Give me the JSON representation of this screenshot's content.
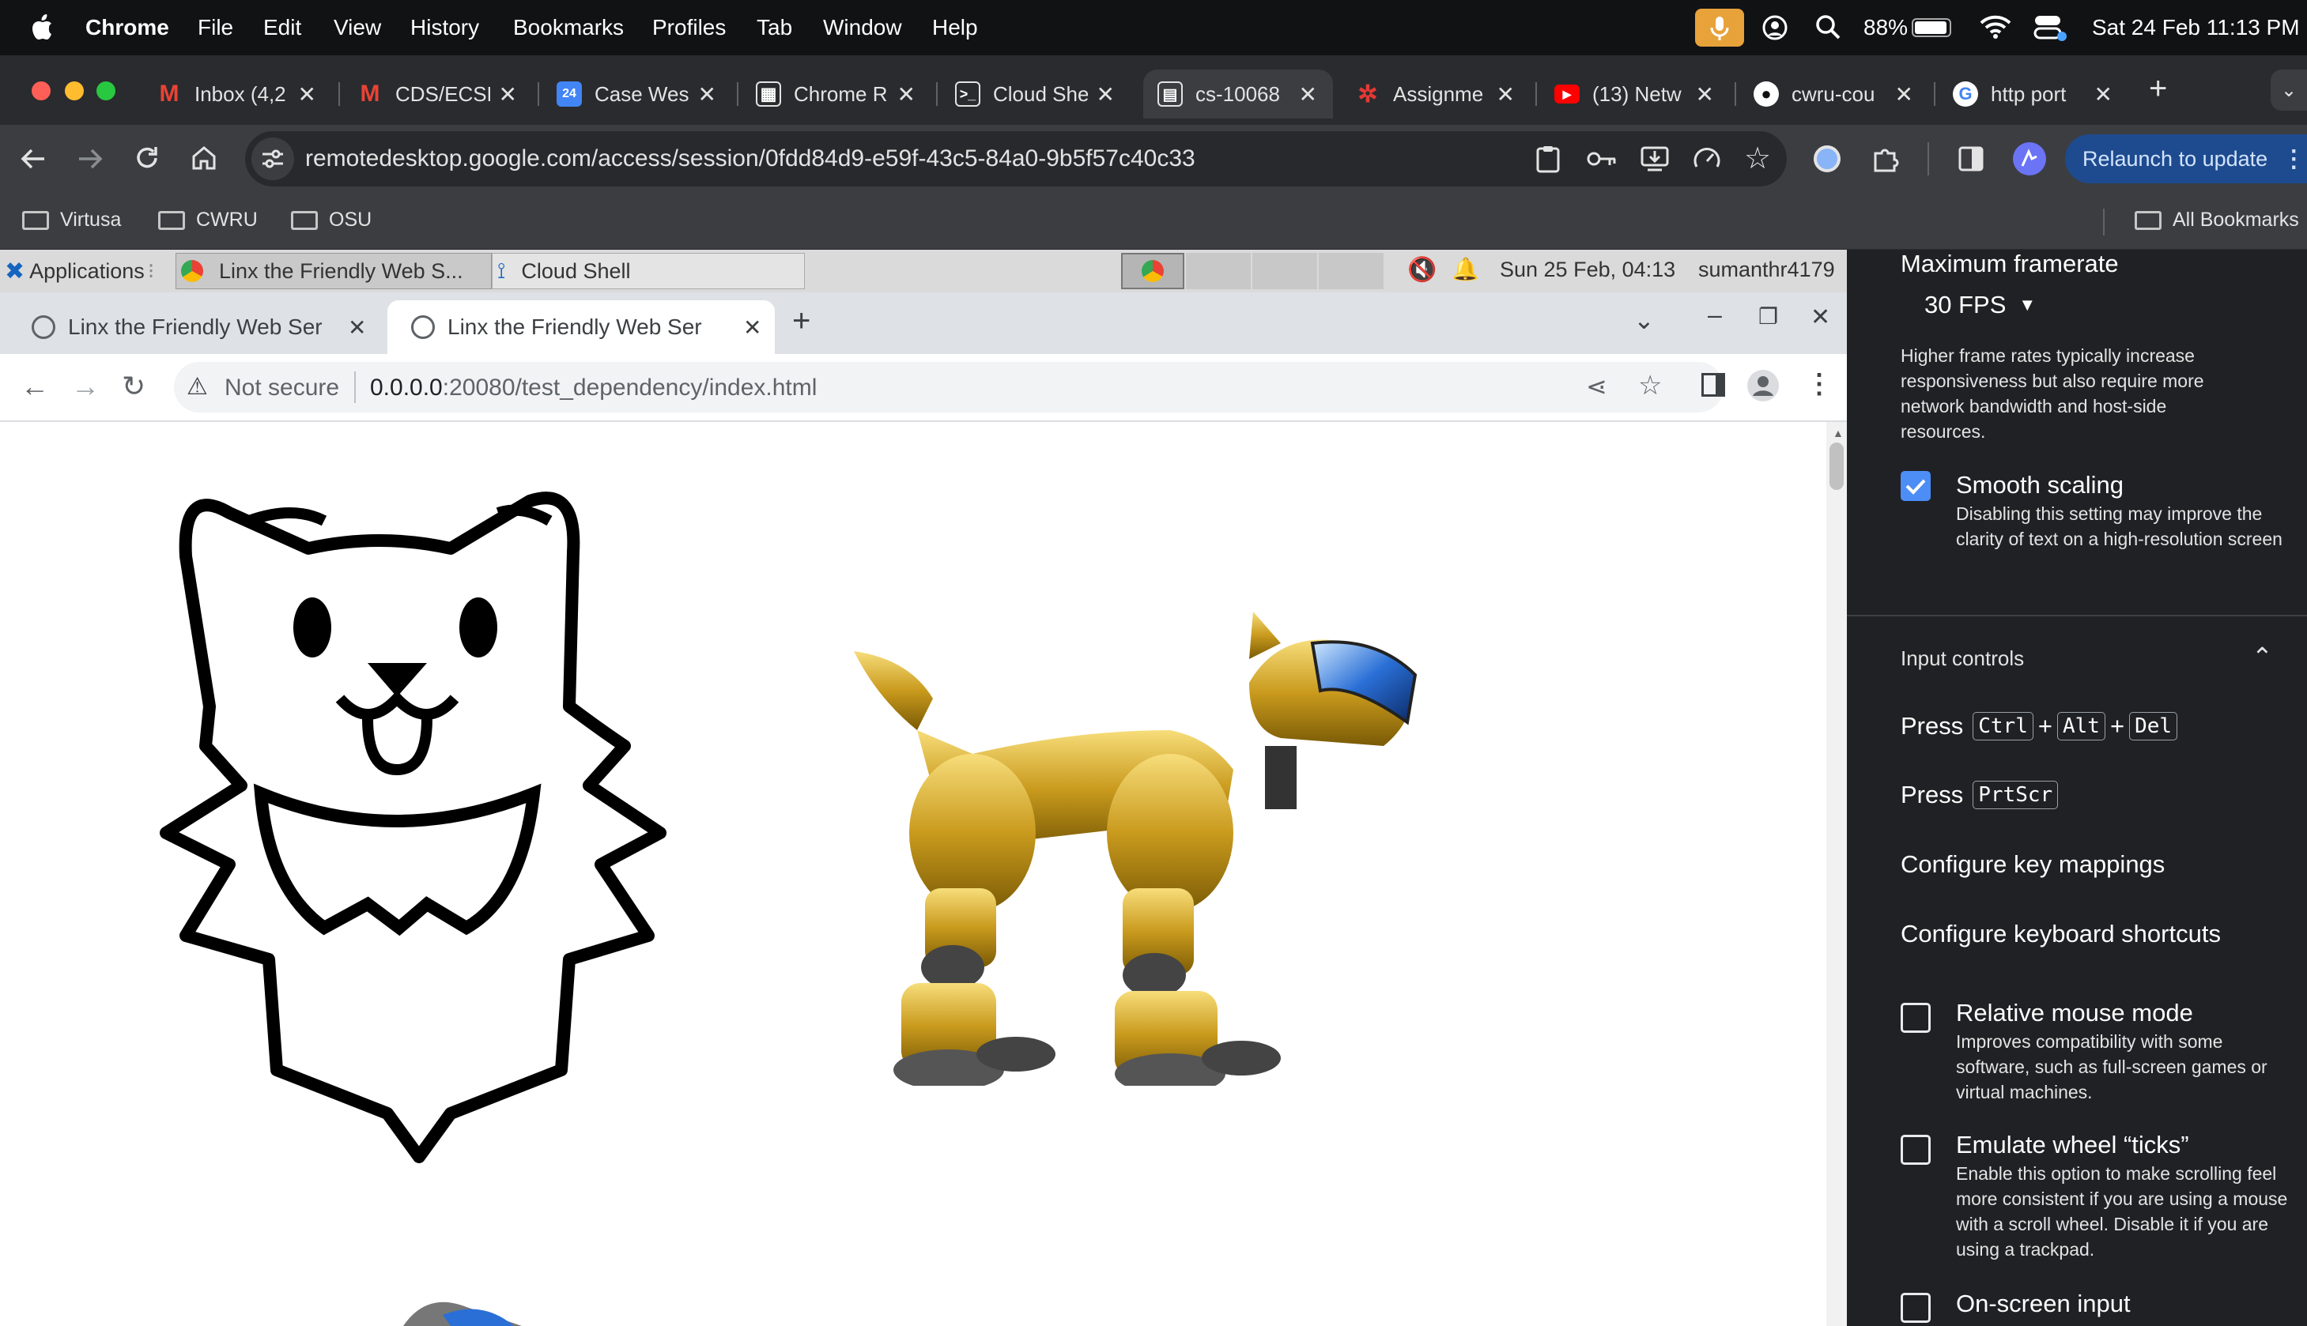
{
  "menubar": {
    "app": "Chrome",
    "items": [
      "File",
      "Edit",
      "View",
      "History",
      "Bookmarks",
      "Profiles",
      "Tab",
      "Window",
      "Help"
    ],
    "battery": "88%",
    "clock": "Sat 24 Feb  11:13 PM"
  },
  "tabs": [
    {
      "title": "Inbox (4,2",
      "icon": "gmail-icon",
      "color": "#ea4335",
      "glyph": "M"
    },
    {
      "title": "CDS/ECSE",
      "icon": "gmail-icon",
      "color": "#ea4335",
      "glyph": "M"
    },
    {
      "title": "Case West",
      "icon": "calendar-icon",
      "color": "#4285f4",
      "glyph": "24"
    },
    {
      "title": "Chrome R",
      "icon": "grid-icon",
      "color": "#5f6368",
      "glyph": "▦"
    },
    {
      "title": "Cloud She",
      "icon": "terminal-icon",
      "color": "#5f6368",
      "glyph": "▣"
    },
    {
      "title": "cs-10068",
      "icon": "remote-desktop-icon",
      "color": "#5f6368",
      "glyph": "▤"
    },
    {
      "title": "Assignme",
      "icon": "assignment-icon",
      "color": "#c62828",
      "glyph": "✲"
    },
    {
      "title": "(13) Netw",
      "icon": "youtube-icon",
      "color": "#ff0000",
      "glyph": "▶"
    },
    {
      "title": "cwru-cou",
      "icon": "github-icon",
      "color": "#111111",
      "glyph": "●"
    },
    {
      "title": "http port",
      "icon": "google-icon",
      "color": "#4285f4",
      "glyph": "G"
    }
  ],
  "toolbar": {
    "url": "remotedesktop.google.com/access/session/0fdd84d9-e59f-43c5-84a0-9b5f57c40c33",
    "relaunch": "Relaunch to update"
  },
  "bookmarks": [
    "Virtusa",
    "CWRU",
    "OSU"
  ],
  "all_bookmarks": "All Bookmarks",
  "remote": {
    "applications": "Applications",
    "task1": "Linx the Friendly Web S...",
    "task2": "Cloud Shell",
    "clock": "Sun 25 Feb, 04:13",
    "user": "sumanthr4179",
    "tab1": "Linx the Friendly Web Ser",
    "tab2": "Linx the Friendly Web Ser",
    "not_secure": "Not secure",
    "url_host": "0.0.0.0",
    "url_path": ":20080/test_dependency/index.html"
  },
  "side": {
    "framerate_title": "Maximum framerate",
    "fps": "30 FPS",
    "framerate_desc": "Higher frame rates typically increase responsiveness but also require more network bandwidth and host-side resources.",
    "smooth_title": "Smooth scaling",
    "smooth_desc": "Disabling this setting may improve the clarity of text on a high-resolution screen",
    "input_controls": "Input controls",
    "press": "Press",
    "key_ctrl": "Ctrl",
    "key_alt": "Alt",
    "key_del": "Del",
    "plus": "+",
    "key_prtscr": "PrtScr",
    "configure_keys": "Configure key mappings",
    "configure_shortcuts": "Configure keyboard shortcuts",
    "relative_title": "Relative mouse mode",
    "relative_desc": "Improves compatibility with some software, such as full-screen games or virtual machines.",
    "wheel_title": "Emulate wheel “ticks”",
    "wheel_desc": "Enable this option to make scrolling feel more consistent if you are using a mouse with a scroll wheel. Disable it if you are using a trackpad.",
    "onscreen_title": "On-screen input"
  }
}
